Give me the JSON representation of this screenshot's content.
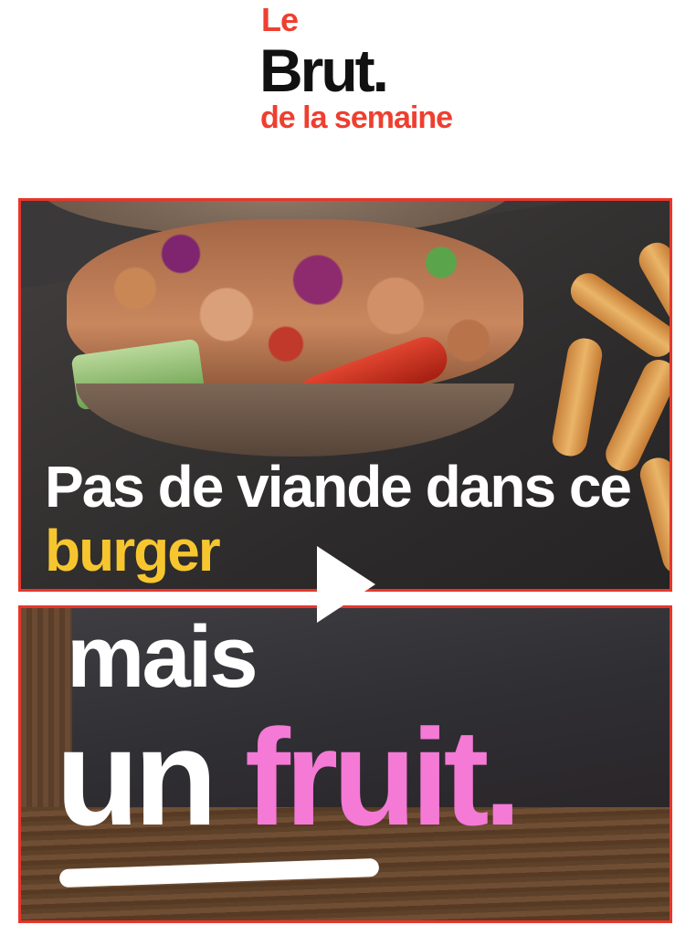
{
  "logo": {
    "line1": "Le",
    "line2": "Brut.",
    "line3": "de la semaine"
  },
  "video": {
    "top_caption": {
      "part1": "Pas de viande dans ce ",
      "highlight": "burger"
    },
    "bottom_caption": {
      "line1": "mais",
      "line2_part1": "un ",
      "line2_highlight": "fruit."
    },
    "play_icon": "play-icon"
  },
  "colors": {
    "brand_red": "#ee3f2f",
    "frame_border": "#e8362b",
    "highlight_yellow": "#f7c62f",
    "highlight_pink": "#f47ad6"
  }
}
